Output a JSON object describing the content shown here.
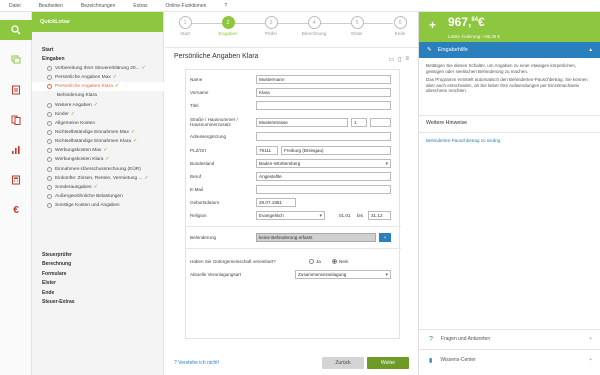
{
  "menu": [
    "Datei",
    "Bearbeiten",
    "Bezeichnungen",
    "Extras",
    "Online-Funktionen",
    "?"
  ],
  "sidebar": {
    "title": "QuickLotse",
    "items": [
      {
        "label": "Start",
        "type": "bold"
      },
      {
        "label": "Eingaben",
        "type": "bold"
      },
      {
        "label": "Vorbereitung Ihrer Steuererklärung 20...",
        "type": "sub",
        "check": true
      },
      {
        "label": "Persönliche Angaben Max",
        "type": "sub",
        "check": true
      },
      {
        "label": "Persönliche Angaben Klara",
        "type": "active",
        "check": true
      },
      {
        "label": "Behinderung Klara",
        "type": "subsub"
      },
      {
        "label": "Weitere Angaben",
        "type": "sub",
        "check": true
      },
      {
        "label": "Kinder",
        "type": "sub",
        "check": true
      },
      {
        "label": "Allgemeine Kosten",
        "type": "sub"
      },
      {
        "label": "Nichtselbständige Einnahmen Max",
        "type": "sub",
        "check": true
      },
      {
        "label": "Nichtselbständige Einnahmen Klara",
        "type": "sub",
        "check": true
      },
      {
        "label": "Werbungskosten Max",
        "type": "sub",
        "check": true
      },
      {
        "label": "Werbungskosten Klara",
        "type": "sub",
        "check": true
      },
      {
        "label": "Einnahmen-Überschussrechnung (EÜR)",
        "type": "sub"
      },
      {
        "label": "Einkünfte: Zinsen, Renten, Vermietung ...",
        "type": "sub",
        "check": true
      },
      {
        "label": "Sonderausgaben",
        "type": "sub",
        "check": true
      },
      {
        "label": "Außergewöhnliche Belastungen",
        "type": "sub"
      },
      {
        "label": "Sonstige Kosten und Angaben",
        "type": "sub"
      },
      {
        "label": "Steuerprüfer",
        "type": "bold"
      },
      {
        "label": "Berechnung",
        "type": "bold"
      },
      {
        "label": "Formulare",
        "type": "bold"
      },
      {
        "label": "Elster",
        "type": "bold"
      },
      {
        "label": "Ende",
        "type": "bold"
      },
      {
        "label": "Steuer-Extras",
        "type": "bold"
      }
    ]
  },
  "steps": [
    {
      "num": "1",
      "label": "Start"
    },
    {
      "num": "2",
      "label": "Eingaben"
    },
    {
      "num": "3",
      "label": "Prüfer"
    },
    {
      "num": "4",
      "label": "Berechnung"
    },
    {
      "num": "5",
      "label": "Elster"
    },
    {
      "num": "6",
      "label": "Ende"
    }
  ],
  "page": {
    "title": "Persönliche Angaben Klara",
    "fields": {
      "name_label": "Name",
      "name": "Mustermann",
      "vorname_label": "Vorname",
      "vorname": "Klara",
      "titel_label": "Titel",
      "titel": "",
      "strasse_label": "Straße / Hausnummer / Hausnummerzusatz",
      "strasse": "Musterstrasse",
      "hausnr": "1",
      "hauszusatz": "",
      "adress_label": "Adressergänzung",
      "adress": "",
      "plz_label": "PLZ/Ort",
      "plz": "79111",
      "ort": "Freiburg (Breisgau)",
      "bundesland_label": "Bundesland",
      "bundesland": "Baden-Württemberg",
      "beruf_label": "Beruf",
      "beruf": "Angestellte",
      "email_label": "E-Mail",
      "email": "",
      "geb_label": "Geburtsdatum",
      "geb": "28.07.1981",
      "religion_label": "Religion",
      "religion": "Evangelisch",
      "rel_from": "01.01",
      "rel_bis": "bis",
      "rel_to": "31.12",
      "behinderung_label": "Behinderung",
      "behinderung": "keine Behinderung erfasst",
      "behinderung_btn": "+",
      "guter_label": "Haben Sie Gütergemeinschaft vereinbart?",
      "ja": "Ja",
      "nein": "Nein",
      "veranlagung_label": "Aktuelle Veranlagungsart",
      "veranlagung": "Zusammenveranlagung"
    },
    "help_link": "Verstehe ich nicht!",
    "back": "Zurück",
    "next": "Weiter"
  },
  "right": {
    "amount": "967,",
    "amount_cents": "84",
    "currency": "€",
    "change": "Letzte Änderung: +95,36 €",
    "help_title": "Eingabehilfe",
    "help_text_1": "Betätigen Sie diesen Schalter, um Angaben zu einer etwaigen körperlichen, geistigen oder seelischen Behinderung zu machen.",
    "help_text_2": "Das Programm ermittelt automatisch den Behinderten-Pauschbetrag. Sie können aber auch entscheiden, ob Sie lieber Ihre Aufwendungen per Einzelnachweis abrechnen möchten.",
    "more_title": "Weitere Hinweise",
    "more_link": "Behinderten-Pauschbetrag zu niedrig",
    "faq": "Fragen und Antworten",
    "wissen": "Wissens-Center",
    "accent": "#8dc63f",
    "blue": "#2a7fbd"
  }
}
